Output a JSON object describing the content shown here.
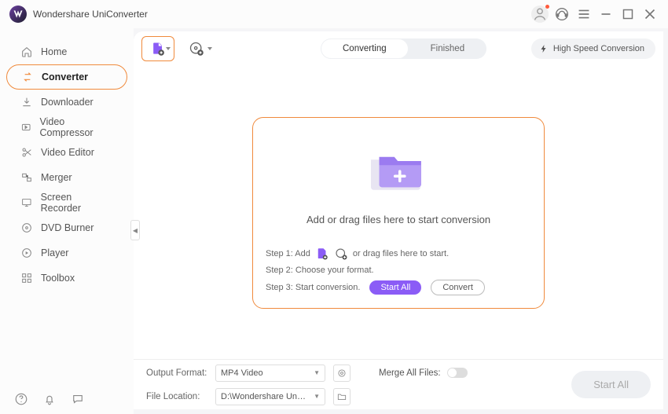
{
  "titlebar": {
    "title": "Wondershare UniConverter"
  },
  "sidebar": {
    "items": [
      {
        "label": "Home"
      },
      {
        "label": "Converter"
      },
      {
        "label": "Downloader"
      },
      {
        "label": "Video Compressor"
      },
      {
        "label": "Video Editor"
      },
      {
        "label": "Merger"
      },
      {
        "label": "Screen Recorder"
      },
      {
        "label": "DVD Burner"
      },
      {
        "label": "Player"
      },
      {
        "label": "Toolbox"
      }
    ]
  },
  "tabs": {
    "converting": "Converting",
    "finished": "Finished"
  },
  "hsc": "High Speed Conversion",
  "dropzone": {
    "main": "Add or drag files here to start conversion",
    "step1a": "Step 1: Add",
    "step1b": "or drag files here to start.",
    "step2": "Step 2: Choose your format.",
    "step3": "Step 3: Start conversion.",
    "startAll": "Start All",
    "convert": "Convert"
  },
  "footer": {
    "outputFormatLabel": "Output Format:",
    "outputFormat": "MP4 Video",
    "fileLocationLabel": "File Location:",
    "fileLocation": "D:\\Wondershare UniConverter",
    "mergeLabel": "Merge All Files:",
    "startAll": "Start All"
  }
}
